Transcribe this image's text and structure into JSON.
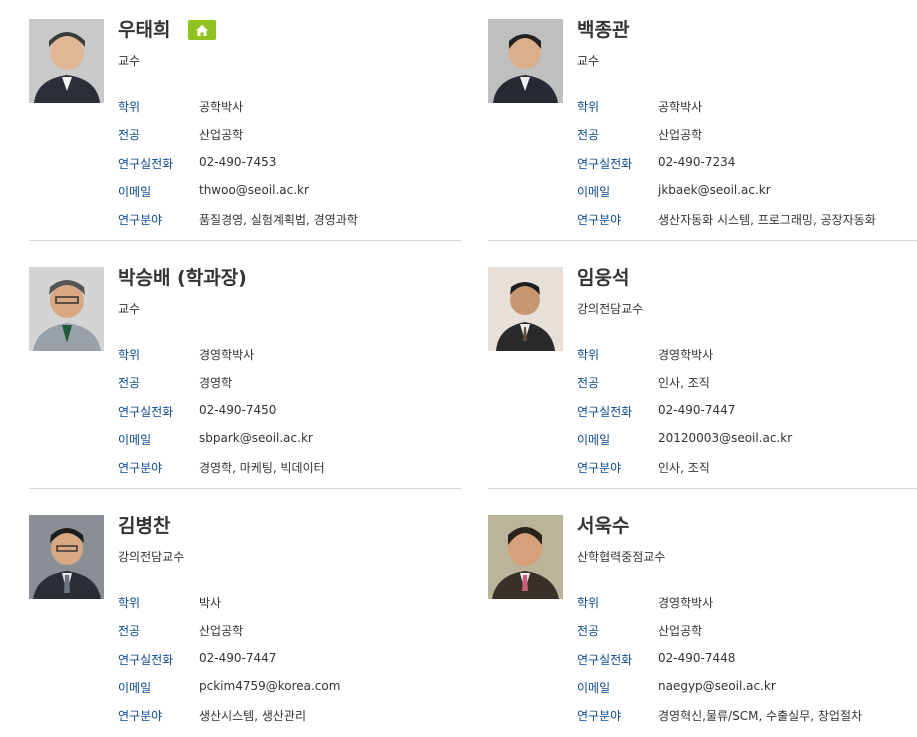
{
  "field_labels": {
    "degree": "학위",
    "major": "전공",
    "phone": "연구실전화",
    "email": "이메일",
    "research": "연구분야"
  },
  "accent_colors": {
    "label": "#0b4a8b",
    "home_button": "#8dc21f",
    "divider": "#d6d6d6"
  },
  "professors": [
    {
      "name": "우태희",
      "title": "교수",
      "degree": "공학박사",
      "major": "산업공학",
      "phone": "02-490-7453",
      "email": "thwoo@seoil.ac.kr",
      "research": "품질경영, 실험계획법, 경영과학",
      "home_icon": "home-icon"
    },
    {
      "name": "백종관",
      "title": "교수",
      "degree": "공학박사",
      "major": "산업공학",
      "phone": "02-490-7234",
      "email": "jkbaek@seoil.ac.kr",
      "research": "생산자동화 시스템, 프로그래밍, 공장자동화"
    },
    {
      "name": "박승배 (학과장)",
      "title": "교수",
      "degree": "경영학박사",
      "major": "경영학",
      "phone": "02-490-7450",
      "email": "sbpark@seoil.ac.kr",
      "research": "경영학, 마케팅, 빅데이터"
    },
    {
      "name": "임웅석",
      "title": "강의전담교수",
      "degree": "경영학박사",
      "major": "인사, 조직",
      "phone": "02-490-7447",
      "email": "20120003@seoil.ac.kr",
      "research": "인사, 조직"
    },
    {
      "name": "김병찬",
      "title": "강의전담교수",
      "degree": "박사",
      "major": "산업공학",
      "phone": "02-490-7447",
      "email": "pckim4759@korea.com",
      "research": "생산시스템, 생산관리"
    },
    {
      "name": "서욱수",
      "title": "산학협력중점교수",
      "degree": "경영학박사",
      "major": "산업공학",
      "phone": "02-490-7448",
      "email": "naegyp@seoil.ac.kr",
      "research": "경영혁신,물류/SCM, 수출실무, 창업절차"
    }
  ]
}
